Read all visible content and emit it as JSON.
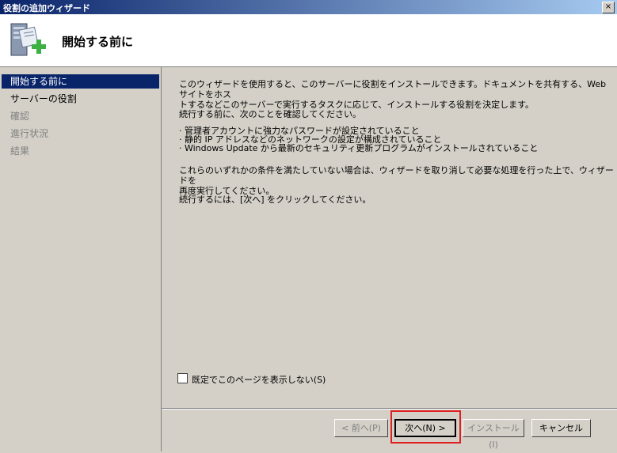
{
  "window": {
    "title": "役割の追加ウィザード",
    "close_label": "×"
  },
  "header": {
    "title": "開始する前に",
    "icon": "server-add-icon"
  },
  "sidebar": {
    "items": [
      {
        "label": "開始する前に",
        "state": "active"
      },
      {
        "label": "サーバーの役割",
        "state": "normal"
      },
      {
        "label": "確認",
        "state": "disabled"
      },
      {
        "label": "進行状況",
        "state": "disabled"
      },
      {
        "label": "結果",
        "state": "disabled"
      }
    ]
  },
  "content": {
    "intro_line1": "このウィザードを使用すると、このサーバーに役割をインストールできます。ドキュメントを共有する、Web サイトをホス",
    "intro_line2": "トするなどこのサーバーで実行するタスクに応じて、インストールする役割を決定します。",
    "confirm_intro": "続行する前に、次のことを確認してください。",
    "bullets": [
      "· 管理者アカウントに強力なパスワードが設定されていること",
      "· 静的 IP アドレスなどのネットワークの設定が構成されていること",
      "· Windows Update から最新のセキュリティ更新プログラムがインストールされていること"
    ],
    "warning_line1": "これらのいずれかの条件を満たしていない場合は、ウィザードを取り消して必要な処理を行った上で、ウィザードを",
    "warning_line2": "再度実行してください。",
    "continue_text": "続行するには、[次へ] をクリックしてください。",
    "skip_checkbox_label": "既定でこのページを表示しない(S)",
    "skip_checkbox_checked": false
  },
  "buttons": {
    "prev": "< 前へ(P)",
    "next": "次へ(N) >",
    "install": "インストール(I)",
    "cancel": "キャンセル"
  },
  "colors": {
    "titlebar_start": "#0a246a",
    "titlebar_end": "#a6caf0",
    "active_nav": "#0a246a",
    "highlight": "#e02020"
  }
}
